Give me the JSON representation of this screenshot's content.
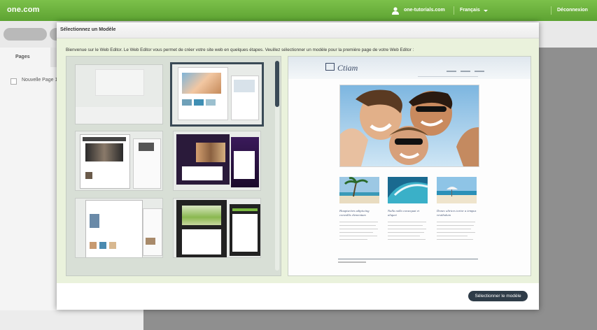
{
  "topbar": {
    "logo": "one.com",
    "username": "one-tutorials.com",
    "language": "Français",
    "logout": "Déconnexion"
  },
  "editor": {
    "pages_tab": "Pages",
    "page_item": "Nouvelle Page 1"
  },
  "modal": {
    "title": "Sélectionnez un Modèle",
    "intro": "Bienvenue sur le Web Editor. Le Web Editor vous permet de créer votre site web en quelques étapes. Veuillez sélectionner un modèle pour la première page de votre Web Editor :",
    "select_button": "Sélectionner le modèle"
  },
  "preview": {
    "logo": "Ctiam",
    "captions": [
      "Hauptseiten adipiscing convallis elementum",
      "Nulla nulla consequat et aliquet",
      "Donec ultrices tortor a tempus vestibulum"
    ]
  },
  "colors": {
    "brand_green": "#6cb33e",
    "modal_body": "#eaf2dc",
    "selection_border": "#3a4a56",
    "button": "#2f3c48"
  }
}
